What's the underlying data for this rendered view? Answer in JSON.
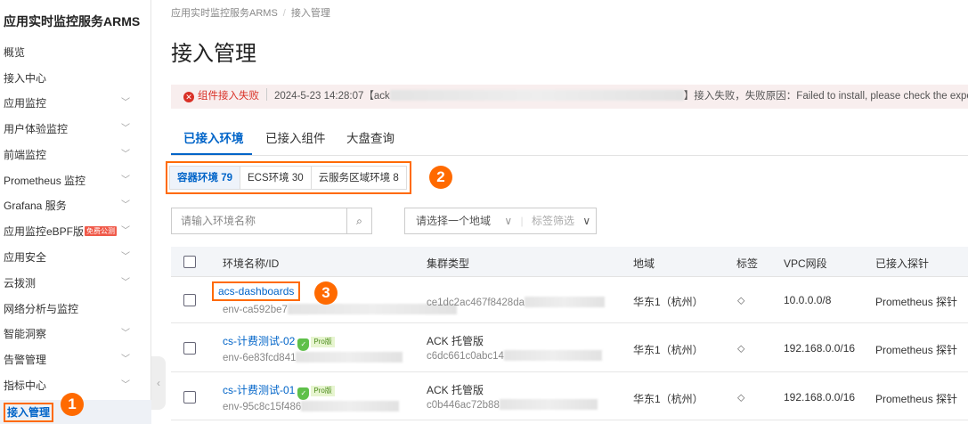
{
  "sidebar": {
    "title": "应用实时监控服务ARMS",
    "items": [
      {
        "label": "概览",
        "expandable": false
      },
      {
        "label": "接入中心",
        "expandable": false
      },
      {
        "label": "应用监控",
        "expandable": true
      },
      {
        "label": "用户体验监控",
        "expandable": true
      },
      {
        "label": "前端监控",
        "expandable": true
      },
      {
        "label": "Prometheus 监控",
        "expandable": true
      },
      {
        "label": "Grafana 服务",
        "expandable": true
      },
      {
        "label": "应用监控eBPF版",
        "badge": "免费公测",
        "expandable": true
      },
      {
        "label": "应用安全",
        "expandable": true
      },
      {
        "label": "云拨测",
        "expandable": true
      },
      {
        "label": "网络分析与监控",
        "expandable": false
      },
      {
        "label": "智能洞察",
        "expandable": true
      },
      {
        "label": "告警管理",
        "expandable": true
      },
      {
        "label": "指标中心",
        "expandable": true
      }
    ],
    "active": "接入管理"
  },
  "markers": [
    "1",
    "2",
    "3"
  ],
  "breadcrumb": [
    "应用实时监控服务ARMS",
    "接入管理"
  ],
  "page_title": "接入管理",
  "alert": {
    "title": "组件接入失败",
    "time": "2024-5-23 14:28:07",
    "prefix": "【ack",
    "message": "】接入失败，失败原因：Failed to install, please check the exporter status"
  },
  "tabs": [
    "已接入环境",
    "已接入组件",
    "大盘查询"
  ],
  "segments": [
    "容器环境 79",
    "ECS环境 30",
    "云服务区域环境 8"
  ],
  "search": {
    "placeholder": "请输入环境名称"
  },
  "filters": {
    "region": "请选择一个地域",
    "tags": "标签筛选"
  },
  "table": {
    "headers": [
      "环境名称/ID",
      "集群类型",
      "地域",
      "标签",
      "VPC网段",
      "已接入探针"
    ],
    "rows": [
      {
        "name": "acs-dashboards",
        "id": "env-ca592be7",
        "cluster_type": "",
        "cluster_id": "ce1dc2ac467f8428da",
        "region": "华东1（杭州）",
        "vpc": "10.0.0.0/8",
        "probe": "Prometheus 探针",
        "pro": false
      },
      {
        "name": "cs-计费测试-02",
        "id": "env-6e83fcd841",
        "cluster_type": "ACK 托管版",
        "cluster_id": "c6dc661c0abc14",
        "region": "华东1（杭州）",
        "vpc": "192.168.0.0/16",
        "probe": "Prometheus 探针",
        "pro": true,
        "pro_label": "Pro版"
      },
      {
        "name": "cs-计费测试-01",
        "id": "env-95c8c15f486",
        "cluster_type": "ACK 托管版",
        "cluster_id": "c0b446ac72b88",
        "region": "华东1（杭州）",
        "vpc": "192.168.0.0/16",
        "probe": "Prometheus 探针",
        "pro": true,
        "pro_label": "Pro版"
      }
    ]
  }
}
